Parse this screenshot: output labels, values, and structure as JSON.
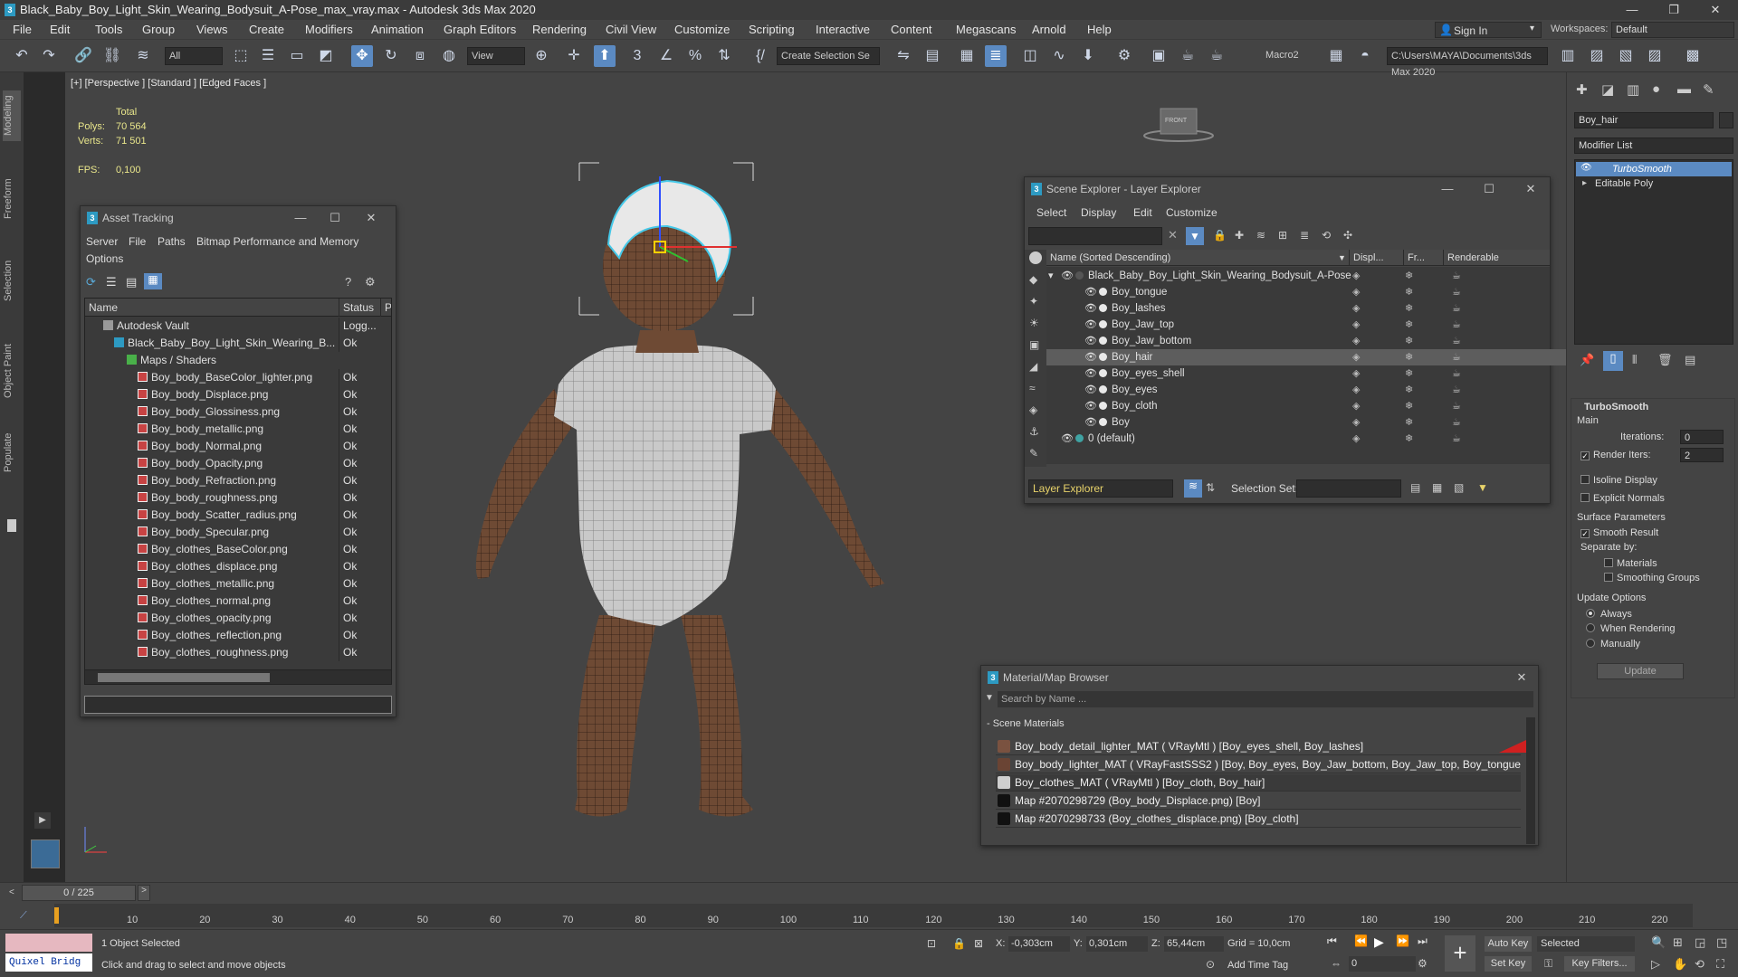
{
  "window": {
    "title": "Black_Baby_Boy_Light_Skin_Wearing_Bodysuit_A-Pose_max_vray.max - Autodesk 3ds Max 2020"
  },
  "menu": [
    "File",
    "Edit",
    "Tools",
    "Group",
    "Views",
    "Create",
    "Modifiers",
    "Animation",
    "Graph Editors",
    "Rendering",
    "Civil View",
    "Customize",
    "Scripting",
    "Interactive",
    "Content",
    "Megascans",
    "Arnold",
    "Help"
  ],
  "account": {
    "signin": "Sign In",
    "workspaces_label": "Workspaces:",
    "workspace": "Default"
  },
  "toolbar": {
    "filter": "All",
    "view": "View",
    "create_selection": "Create Selection Se",
    "macro": "Macro2",
    "path": "C:\\Users\\MAYA\\Documents\\3ds Max 2020"
  },
  "ribbon_tabs": [
    "Modeling",
    "Freeform",
    "Selection",
    "Object Paint",
    "Populate"
  ],
  "viewport": {
    "label": "[+] [Perspective ] [Standard ] [Edged Faces ]",
    "stats": {
      "total_label": "Total",
      "polys_label": "Polys:",
      "polys": "70 564",
      "verts_label": "Verts:",
      "verts": "71 501",
      "fps_label": "FPS:",
      "fps": "0,100"
    },
    "viewcube_label": "FRONT"
  },
  "asset_tracking": {
    "title": "Asset Tracking",
    "menu": [
      "Server",
      "File",
      "Paths",
      "Bitmap Performance and Memory",
      "Options"
    ],
    "columns": {
      "name": "Name",
      "status": "Status",
      "p": "P"
    },
    "rows": [
      {
        "name": "Autodesk Vault",
        "status": "Logg..."
      },
      {
        "name": "Black_Baby_Boy_Light_Skin_Wearing_B...",
        "status": "Ok"
      },
      {
        "name": "Maps / Shaders",
        "status": ""
      },
      {
        "name": "Boy_body_BaseColor_lighter.png",
        "status": "Ok"
      },
      {
        "name": "Boy_body_Displace.png",
        "status": "Ok"
      },
      {
        "name": "Boy_body_Glossiness.png",
        "status": "Ok"
      },
      {
        "name": "Boy_body_metallic.png",
        "status": "Ok"
      },
      {
        "name": "Boy_body_Normal.png",
        "status": "Ok"
      },
      {
        "name": "Boy_body_Opacity.png",
        "status": "Ok"
      },
      {
        "name": "Boy_body_Refraction.png",
        "status": "Ok"
      },
      {
        "name": "Boy_body_roughness.png",
        "status": "Ok"
      },
      {
        "name": "Boy_body_Scatter_radius.png",
        "status": "Ok"
      },
      {
        "name": "Boy_body_Specular.png",
        "status": "Ok"
      },
      {
        "name": "Boy_clothes_BaseColor.png",
        "status": "Ok"
      },
      {
        "name": "Boy_clothes_displace.png",
        "status": "Ok"
      },
      {
        "name": "Boy_clothes_metallic.png",
        "status": "Ok"
      },
      {
        "name": "Boy_clothes_normal.png",
        "status": "Ok"
      },
      {
        "name": "Boy_clothes_opacity.png",
        "status": "Ok"
      },
      {
        "name": "Boy_clothes_reflection.png",
        "status": "Ok"
      },
      {
        "name": "Boy_clothes_roughness.png",
        "status": "Ok"
      }
    ]
  },
  "scene_explorer": {
    "title": "Scene Explorer - Layer Explorer",
    "menu": [
      "Select",
      "Display",
      "Edit",
      "Customize"
    ],
    "columns": {
      "name": "Name (Sorted Descending)",
      "display": "Displ...",
      "freeze": "Fr...",
      "renderable": "Renderable"
    },
    "rows": [
      {
        "name": "Black_Baby_Boy_Light_Skin_Wearing_Bodysuit_A-Pose",
        "level": 0
      },
      {
        "name": "Boy_tongue",
        "level": 1
      },
      {
        "name": "Boy_lashes",
        "level": 1
      },
      {
        "name": "Boy_Jaw_top",
        "level": 1
      },
      {
        "name": "Boy_Jaw_bottom",
        "level": 1
      },
      {
        "name": "Boy_hair",
        "level": 1
      },
      {
        "name": "Boy_eyes_shell",
        "level": 1
      },
      {
        "name": "Boy_eyes",
        "level": 1
      },
      {
        "name": "Boy_cloth",
        "level": 1
      },
      {
        "name": "Boy",
        "level": 1
      },
      {
        "name": "0 (default)",
        "level": 0
      }
    ],
    "footer": {
      "explorer": "Layer Explorer",
      "selection_set": "Selection Set:"
    }
  },
  "material_browser": {
    "title": "Material/Map Browser",
    "search_placeholder": "Search by Name ...",
    "section": "- Scene Materials",
    "rows": [
      "Boy_body_detail_lighter_MAT ( VRayMtl ) [Boy_eyes_shell, Boy_lashes]",
      "Boy_body_lighter_MAT ( VRayFastSSS2 ) [Boy, Boy_eyes, Boy_Jaw_bottom, Boy_Jaw_top, Boy_tongue]",
      "Boy_clothes_MAT ( VRayMtl ) [Boy_cloth, Boy_hair]",
      "Map #2070298729 (Boy_body_Displace.png) [Boy]",
      "Map #2070298733 (Boy_clothes_displace.png) [Boy_cloth]"
    ]
  },
  "command_panel": {
    "object_name": "Boy_hair",
    "modifier_list": "Modifier List",
    "stack": [
      "TurboSmooth",
      "Editable Poly"
    ],
    "turbosmooth": {
      "title": "TurboSmooth",
      "main": "Main",
      "iterations_label": "Iterations:",
      "iterations": "0",
      "render_iters_label": "Render Iters:",
      "render_iters": "2",
      "isoline": "Isoline Display",
      "explicit_normals": "Explicit Normals",
      "surface_params": "Surface Parameters",
      "smooth_result": "Smooth Result",
      "separate_by": "Separate by:",
      "materials": "Materials",
      "smoothing_groups": "Smoothing Groups",
      "update_options": "Update Options",
      "always": "Always",
      "when_rendering": "When Rendering",
      "manually": "Manually",
      "update": "Update"
    }
  },
  "timeline": {
    "frame": "0 / 225",
    "ticks": [
      "10",
      "20",
      "30",
      "40",
      "50",
      "60",
      "70",
      "80",
      "90",
      "100",
      "110",
      "120",
      "130",
      "140",
      "150",
      "160",
      "170",
      "180",
      "190",
      "200",
      "210",
      "220"
    ]
  },
  "status": {
    "script_listener": "Quixel Bridg",
    "selected": "1 Object Selected",
    "prompt": "Click and drag to select and move objects",
    "x_label": "X:",
    "x": "-0,303cm",
    "y_label": "Y:",
    "y": "0,301cm",
    "z_label": "Z:",
    "z": "65,44cm",
    "grid": "Grid = 10,0cm",
    "add_time_tag": "Add Time Tag",
    "auto_key": "Auto Key",
    "set_key": "Set Key",
    "selected_dd": "Selected",
    "key_filters": "Key Filters...",
    "frame_field": "0"
  }
}
